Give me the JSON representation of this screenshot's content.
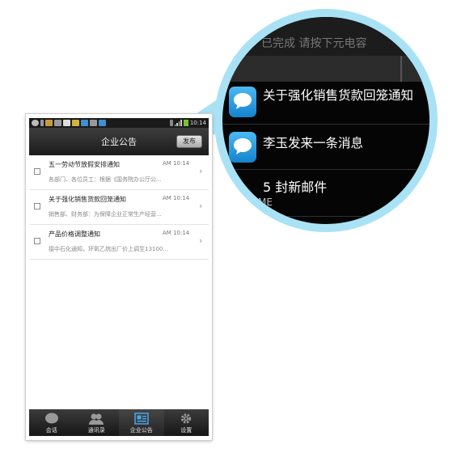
{
  "colors": {
    "zoom_ring": "#a9e2f5",
    "titlebar": "#2a2a2a",
    "accent_icon": "#2a9ee6",
    "battery": "#77c530"
  },
  "status_bar": {
    "icons": [
      "plus-icon",
      "usb-icon",
      "bag-icon",
      "image-icon",
      "mail-icon",
      "app-icon",
      "chat-icon",
      "image-icon",
      "chat-icon",
      "bluetooth-icon",
      "signal-icon",
      "battery-icon"
    ],
    "time": "10:14"
  },
  "header": {
    "title": "企业公告",
    "publish_label": "发布"
  },
  "announcements": [
    {
      "title": "五一劳动节放假安排通知",
      "time": "AM 10:14",
      "snippet": "各部门、各位员工：根据《国务院办公厅公..."
    },
    {
      "title": "关于强化销售货款回笼通知",
      "time": "AM 10:14",
      "snippet": "销售部、财务部：为保障企业正常生产经营..."
    },
    {
      "title": "产品价格调整通知",
      "time": "AM 10:14",
      "snippet": "接中石化通知，环氧乙烷出厂价上调至13100..."
    }
  ],
  "tabs": [
    {
      "label": "会话",
      "icon": "chat-bubble-icon"
    },
    {
      "label": "通讯录",
      "icon": "contacts-icon"
    },
    {
      "label": "企业公告",
      "icon": "notice-board-icon",
      "active": true
    },
    {
      "label": "设置",
      "icon": "gear-icon"
    }
  ],
  "zoom": {
    "top_text": "已完成  请按下元电容",
    "notifications": [
      {
        "text": "关于强化销售货款回笼通知",
        "icon": "chat-bubble-icon"
      },
      {
        "text": "李玉发来一条消息",
        "icon": "chat-bubble-icon"
      },
      {
        "text": "5 封新邮件",
        "sub": "ME",
        "icon": "mail-icon"
      }
    ]
  }
}
